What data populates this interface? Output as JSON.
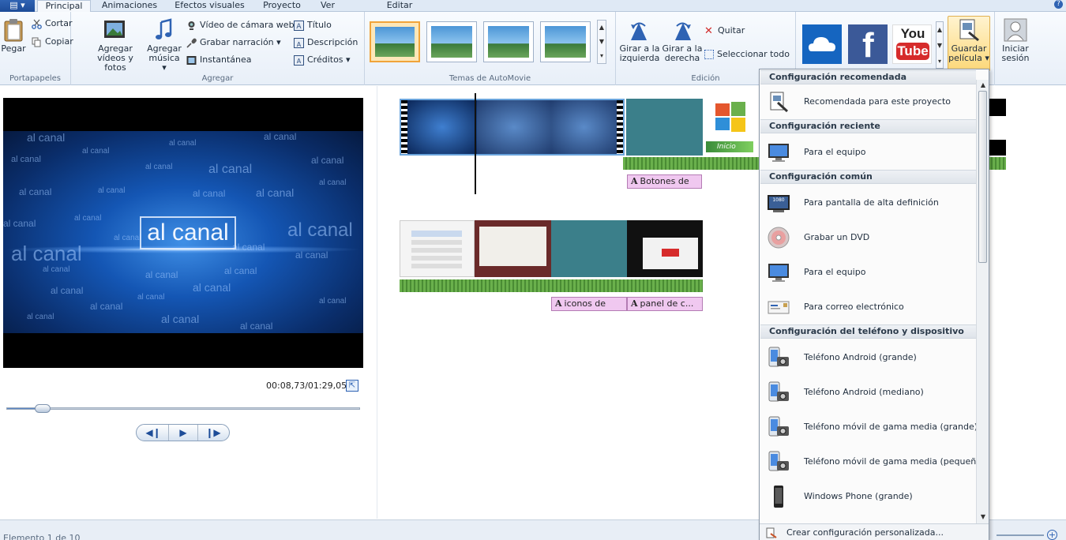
{
  "tabs": [
    {
      "label": "Principal",
      "active": true
    },
    {
      "label": "Animaciones"
    },
    {
      "label": "Efectos visuales"
    },
    {
      "label": "Proyecto"
    },
    {
      "label": "Ver"
    },
    {
      "label": "Editar"
    }
  ],
  "app_menu": {
    "glyph": "▤ ▾"
  },
  "ribbon": {
    "portapapeles": {
      "label": "Portapapeles",
      "pegar": "Pegar",
      "cortar": "Cortar",
      "copiar": "Copiar"
    },
    "agregar": {
      "label": "Agregar",
      "videos_fotos": [
        "Agregar",
        "vídeos y fotos"
      ],
      "musica": [
        "Agregar",
        "música ▾"
      ],
      "camara_web": "Vídeo de cámara web",
      "narracion": "Grabar narración ▾",
      "instantanea": "Instantánea",
      "titulo": "Título",
      "descripcion": "Descripción",
      "creditos": "Créditos ▾"
    },
    "temas": {
      "label": "Temas de AutoMovie"
    },
    "edicion": {
      "label": "Edición",
      "girar_izq": [
        "Girar a la",
        "izquierda"
      ],
      "girar_der": [
        "Girar a la",
        "derecha"
      ],
      "quitar": "Quitar",
      "seleccionar_todo": "Seleccionar todo"
    },
    "compartir": {
      "youtube_top": "You",
      "youtube_bottom": "Tube",
      "facebook": "f",
      "guardar": [
        "Guardar",
        "película ▾"
      ]
    },
    "iniciar_sesion": [
      "Iniciar",
      "sesión"
    ]
  },
  "preview": {
    "logo_text": "al canal",
    "watermark": "al canal",
    "timecode": "00:08,73/01:29,05",
    "seek_fraction": 0.098
  },
  "storyboard": {
    "captions": [
      "Botones de",
      "iconos de",
      "panel de c..."
    ],
    "clip2_banner": "Inicio"
  },
  "status": {
    "text": "Elemento 1 de 10"
  },
  "menu": {
    "sections": {
      "recomendada": "Configuración recomendada",
      "reciente": "Configuración reciente",
      "comun": "Configuración común",
      "telefono": "Configuración del teléfono y dispositivo"
    },
    "items": {
      "recomendada_proyecto": "Recomendada para este proyecto",
      "reciente_equipo": "Para el equipo",
      "alta_definicion": "Para pantalla de alta definición",
      "hd_badge": "1080",
      "grabar_dvd": "Grabar un DVD",
      "para_equipo": "Para el equipo",
      "correo": "Para correo electrónico",
      "android_grande": "Teléfono Android (grande)",
      "android_mediano": "Teléfono Android (mediano)",
      "movil_grande": "Teléfono móvil de gama media (grande)",
      "movil_pequeno": "Teléfono móvil de gama media (pequeño)",
      "windows_phone": "Windows Phone (grande)"
    },
    "footer": "Crear configuración personalizada..."
  }
}
